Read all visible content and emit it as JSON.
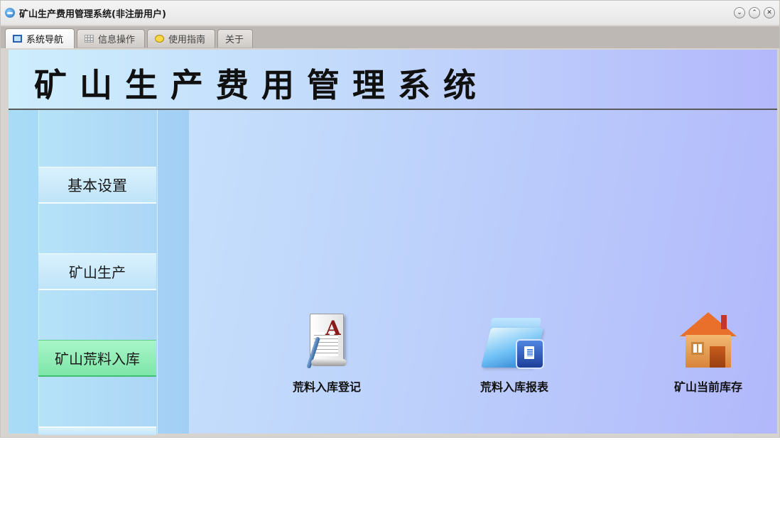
{
  "window": {
    "title": "矿山生产费用管理系统(非注册用户)",
    "controls": {
      "minimize": "⌄",
      "maximize": "⌃",
      "close": "✕"
    }
  },
  "tabs": [
    {
      "label": "系统导航",
      "icon": "monitor-icon",
      "active": true
    },
    {
      "label": "信息操作",
      "icon": "grid-icon",
      "active": false
    },
    {
      "label": "使用指南",
      "icon": "help-icon",
      "active": false
    },
    {
      "label": "关于",
      "icon": "",
      "active": false
    }
  ],
  "header": {
    "title": "矿山生产费用管理系统"
  },
  "sidebar": {
    "items": [
      {
        "label": "基本设置",
        "active": false
      },
      {
        "label": "矿山生产",
        "active": false
      },
      {
        "label": "矿山荒料入库",
        "active": true
      }
    ]
  },
  "functions": [
    {
      "label": "荒料入库登记",
      "icon": "document-edit-icon"
    },
    {
      "label": "荒料入库报表",
      "icon": "folder-report-icon"
    },
    {
      "label": "矿山当前库存",
      "icon": "house-icon"
    }
  ],
  "colors": {
    "active_nav": "#7ee6a8",
    "content_gradient_start": "#cdeafc",
    "content_gradient_end": "#b2b8fb"
  }
}
